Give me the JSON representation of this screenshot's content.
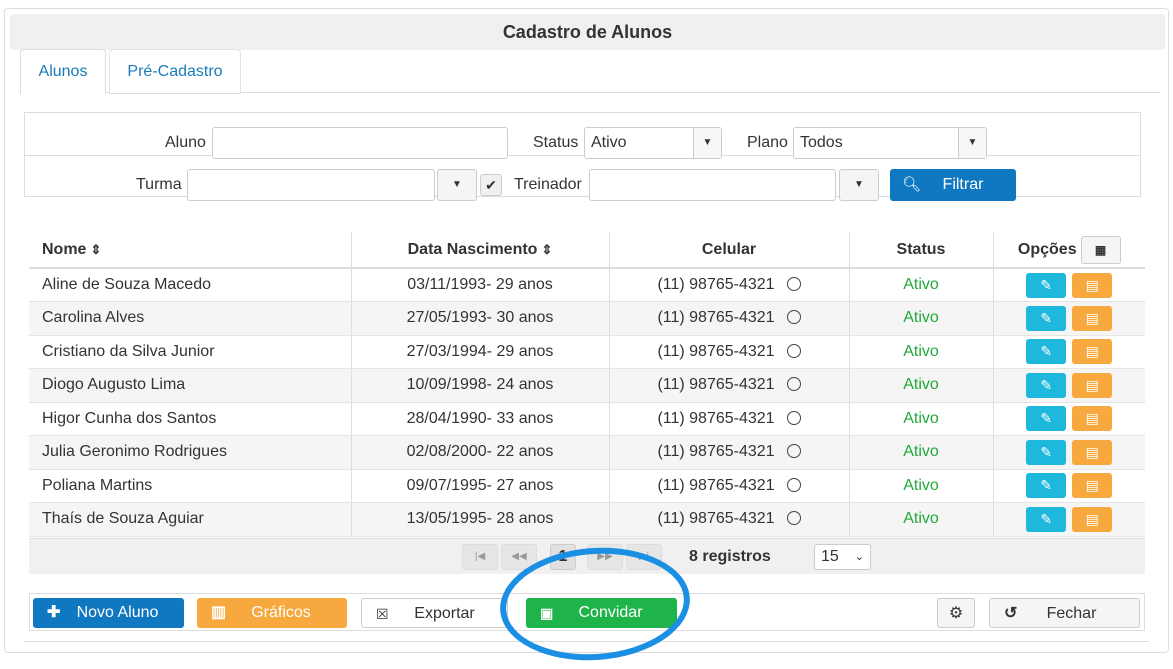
{
  "page": {
    "title": "Cadastro de Alunos"
  },
  "tabs": [
    {
      "label": "Alunos"
    },
    {
      "label": "Pré-Cadastro"
    }
  ],
  "filters": {
    "aluno_label": "Aluno",
    "aluno_value": "",
    "status_label": "Status",
    "status_value": "Ativo",
    "plano_label": "Plano",
    "plano_value": "Todos",
    "turma_label": "Turma",
    "turma_value": "",
    "treinador_label": "Treinador",
    "treinador_value": "",
    "filter_button": "Filtrar"
  },
  "table": {
    "headers": {
      "nome": "Nome",
      "data": "Data Nascimento",
      "celular": "Celular",
      "status": "Status",
      "opcoes": "Opções"
    },
    "rows": [
      {
        "nome": "Aline de Souza Macedo",
        "data": "03/11/1993- 29 anos",
        "celular": "(11) 98765-4321",
        "status": "Ativo"
      },
      {
        "nome": "Carolina Alves",
        "data": "27/05/1993- 30 anos",
        "celular": "(11) 98765-4321",
        "status": "Ativo"
      },
      {
        "nome": "Cristiano da Silva Junior",
        "data": "27/03/1994- 29 anos",
        "celular": "(11) 98765-4321",
        "status": "Ativo"
      },
      {
        "nome": "Diogo Augusto Lima",
        "data": "10/09/1998- 24 anos",
        "celular": "(11) 98765-4321",
        "status": "Ativo"
      },
      {
        "nome": "Higor Cunha dos Santos",
        "data": "28/04/1990- 33 anos",
        "celular": "(11) 98765-4321",
        "status": "Ativo"
      },
      {
        "nome": "Julia Geronimo Rodrigues",
        "data": "02/08/2000- 22 anos",
        "celular": "(11) 98765-4321",
        "status": "Ativo"
      },
      {
        "nome": "Poliana Martins",
        "data": "09/07/1995- 27 anos",
        "celular": "(11) 98765-4321",
        "status": "Ativo"
      },
      {
        "nome": "Thaís de Souza Aguiar",
        "data": "13/05/1995- 28 anos",
        "celular": "(11) 98765-4321",
        "status": "Ativo"
      }
    ]
  },
  "pagination": {
    "current_page": "1",
    "records": "8 registros",
    "page_size": "15"
  },
  "footer": {
    "novo_aluno": "Novo Aluno",
    "graficos": "Gráficos",
    "exportar": "Exportar",
    "convidar": "Convidar",
    "fechar": "Fechar"
  },
  "colors": {
    "primary": "#0f78c0",
    "info": "#1fb8dd",
    "warning": "#f7a83e",
    "success": "#1fb44a",
    "status_active": "#22a83a",
    "annotation_circle": "#1a8fe3"
  },
  "icons": {
    "sort": "sort-icon",
    "whatsapp": "whatsapp-icon",
    "edit": "edit-icon",
    "archive": "archive-icon",
    "columns": "table-columns-icon",
    "search": "search-icon",
    "plus": "plus-icon",
    "chart": "bar-chart-icon",
    "excel": "excel-icon",
    "invite": "contact-card-icon",
    "gear": "gear-icon",
    "undo": "undo-icon"
  }
}
